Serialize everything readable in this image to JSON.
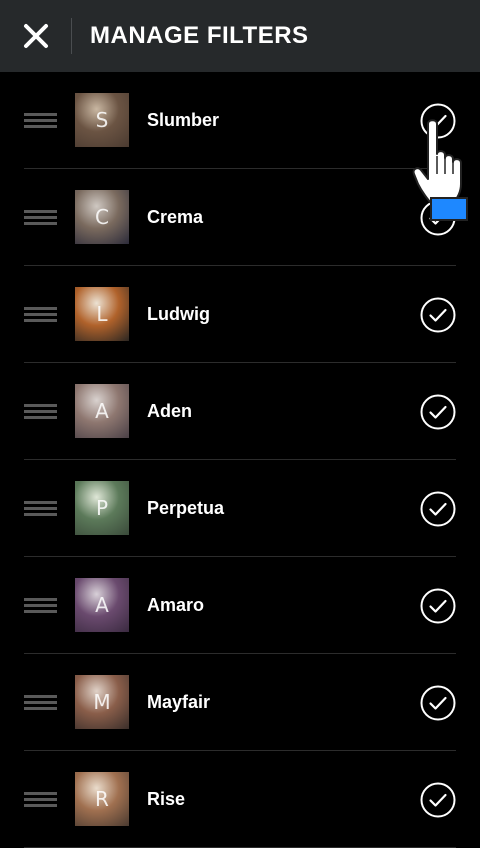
{
  "header": {
    "title": "MANAGE FILTERS",
    "close_icon": "close-icon"
  },
  "filters": [
    {
      "letter": "S",
      "name": "Slumber",
      "checked": true,
      "thumb_colors": [
        "#6b5443",
        "#c9b7a2",
        "#4a3a30"
      ]
    },
    {
      "letter": "C",
      "name": "Crema",
      "checked": true,
      "thumb_colors": [
        "#7a6a5e",
        "#cfc8c2",
        "#2c2b3a"
      ]
    },
    {
      "letter": "L",
      "name": "Ludwig",
      "checked": true,
      "thumb_colors": [
        "#b0622b",
        "#ece2d3",
        "#2a2622"
      ]
    },
    {
      "letter": "A",
      "name": "Aden",
      "checked": true,
      "thumb_colors": [
        "#8e7770",
        "#d9d2cf",
        "#4a4046"
      ]
    },
    {
      "letter": "P",
      "name": "Perpetua",
      "checked": true,
      "thumb_colors": [
        "#5c7a5a",
        "#dfe7d7",
        "#3a4a3a"
      ]
    },
    {
      "letter": "A",
      "name": "Amaro",
      "checked": true,
      "thumb_colors": [
        "#6a4a6e",
        "#d8d0d8",
        "#3a2a40"
      ]
    },
    {
      "letter": "M",
      "name": "Mayfair",
      "checked": true,
      "thumb_colors": [
        "#8a5e4a",
        "#e0d2c8",
        "#3a2e2a"
      ]
    },
    {
      "letter": "R",
      "name": "Rise",
      "checked": true,
      "thumb_colors": [
        "#a07050",
        "#eadccc",
        "#4a3a30"
      ]
    }
  ],
  "icons": {
    "drag": "drag-handle-icon",
    "check": "check-circle-icon",
    "cursor": "hand-pointer-icon"
  }
}
